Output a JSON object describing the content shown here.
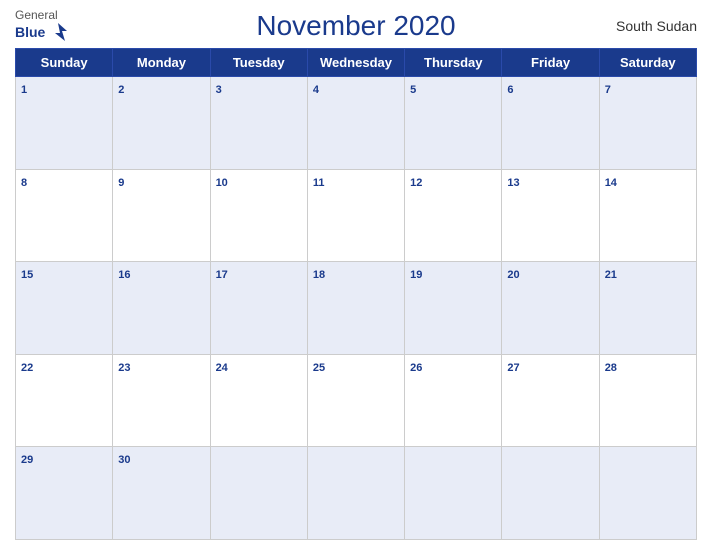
{
  "header": {
    "logo_general": "General",
    "logo_blue": "Blue",
    "title": "November 2020",
    "country": "South Sudan"
  },
  "days_of_week": [
    "Sunday",
    "Monday",
    "Tuesday",
    "Wednesday",
    "Thursday",
    "Friday",
    "Saturday"
  ],
  "weeks": [
    [
      1,
      2,
      3,
      4,
      5,
      6,
      7
    ],
    [
      8,
      9,
      10,
      11,
      12,
      13,
      14
    ],
    [
      15,
      16,
      17,
      18,
      19,
      20,
      21
    ],
    [
      22,
      23,
      24,
      25,
      26,
      27,
      28
    ],
    [
      29,
      30,
      null,
      null,
      null,
      null,
      null
    ]
  ]
}
